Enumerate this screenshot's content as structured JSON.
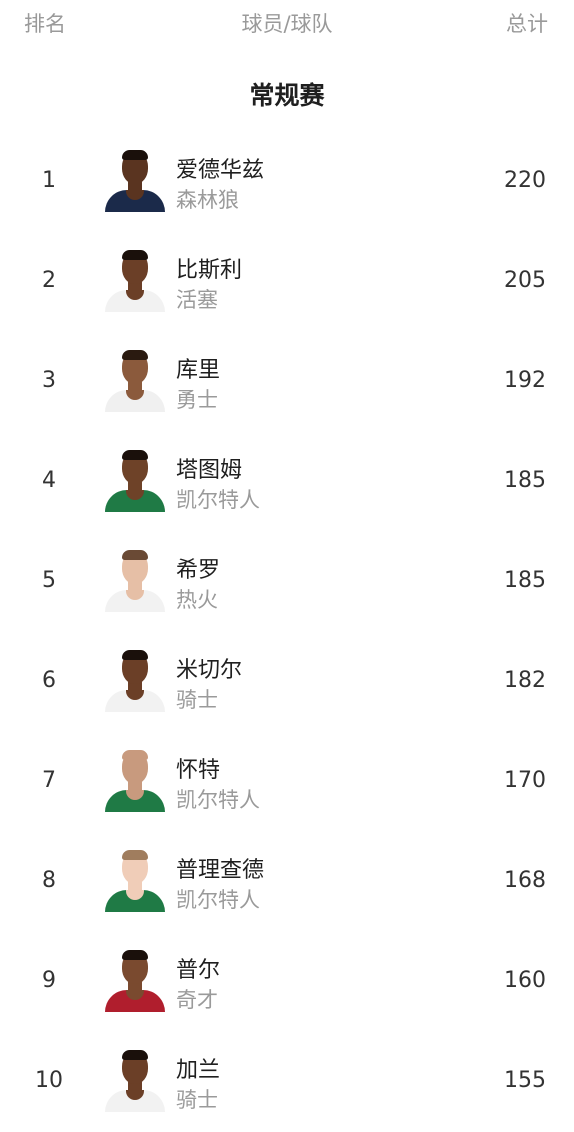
{
  "header": {
    "rank": "排名",
    "player_team": "球员/球队",
    "total": "总计"
  },
  "section_title": "常规赛",
  "players": [
    {
      "rank": "1",
      "name": "爱德华兹",
      "team": "森林狼",
      "total": "220",
      "jersey_color": "#1b2a4a",
      "skin_color": "#5a3420",
      "hair_color": "#1a100b"
    },
    {
      "rank": "2",
      "name": "比斯利",
      "team": "活塞",
      "total": "205",
      "jersey_color": "#f2f2f2",
      "skin_color": "#6b3f27",
      "hair_color": "#1a100b"
    },
    {
      "rank": "3",
      "name": "库里",
      "team": "勇士",
      "total": "192",
      "jersey_color": "#f0f0f0",
      "skin_color": "#8b5a3c",
      "hair_color": "#2a1a10"
    },
    {
      "rank": "4",
      "name": "塔图姆",
      "team": "凯尔特人",
      "total": "185",
      "jersey_color": "#1f7a45",
      "skin_color": "#6e4228",
      "hair_color": "#1a100b"
    },
    {
      "rank": "5",
      "name": "希罗",
      "team": "热火",
      "total": "185",
      "jersey_color": "#f2f2f2",
      "skin_color": "#e6bfa6",
      "hair_color": "#6a4a35"
    },
    {
      "rank": "6",
      "name": "米切尔",
      "team": "骑士",
      "total": "182",
      "jersey_color": "#f2f2f2",
      "skin_color": "#6b3f27",
      "hair_color": "#1a100b"
    },
    {
      "rank": "7",
      "name": "怀特",
      "team": "凯尔特人",
      "total": "170",
      "jersey_color": "#1f7a45",
      "skin_color": "#c89a7e",
      "hair_color": "#c89a7e"
    },
    {
      "rank": "8",
      "name": "普理查德",
      "team": "凯尔特人",
      "total": "168",
      "jersey_color": "#1f7a45",
      "skin_color": "#f0cdb8",
      "hair_color": "#a07d5e"
    },
    {
      "rank": "9",
      "name": "普尔",
      "team": "奇才",
      "total": "160",
      "jersey_color": "#b01e2d",
      "skin_color": "#7a4a2f",
      "hair_color": "#1a100b"
    },
    {
      "rank": "10",
      "name": "加兰",
      "team": "骑士",
      "total": "155",
      "jersey_color": "#f2f2f2",
      "skin_color": "#6b3f27",
      "hair_color": "#1a100b"
    }
  ]
}
